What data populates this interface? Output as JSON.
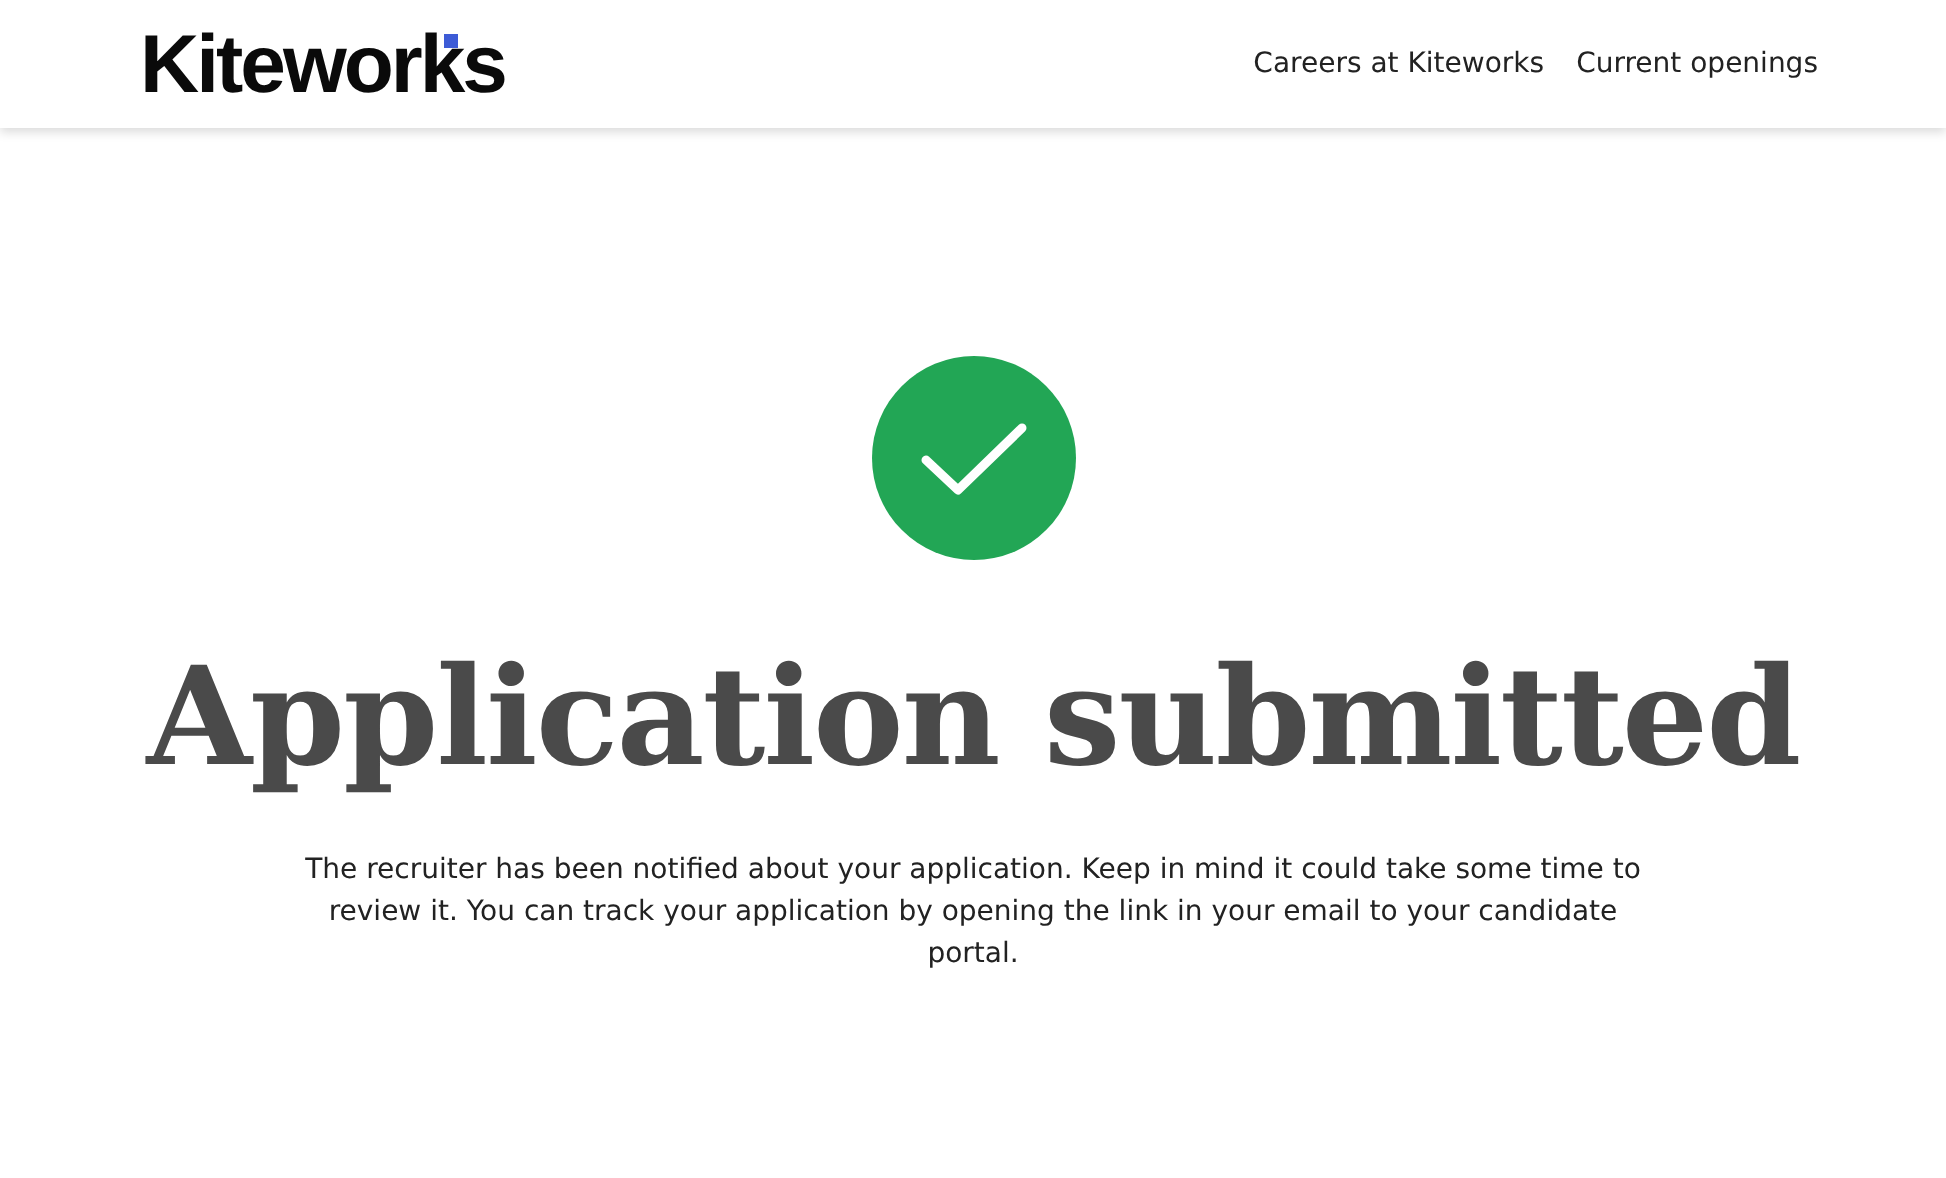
{
  "header": {
    "logo": "Kiteworks",
    "nav": [
      {
        "label": "Careers at Kiteworks"
      },
      {
        "label": "Current openings"
      }
    ]
  },
  "confirmation": {
    "title": "Application submitted",
    "message": "The recruiter has been notified about your application. Keep in mind it could take some time to review it. You can track your application by opening the link in your email to your candidate portal."
  }
}
